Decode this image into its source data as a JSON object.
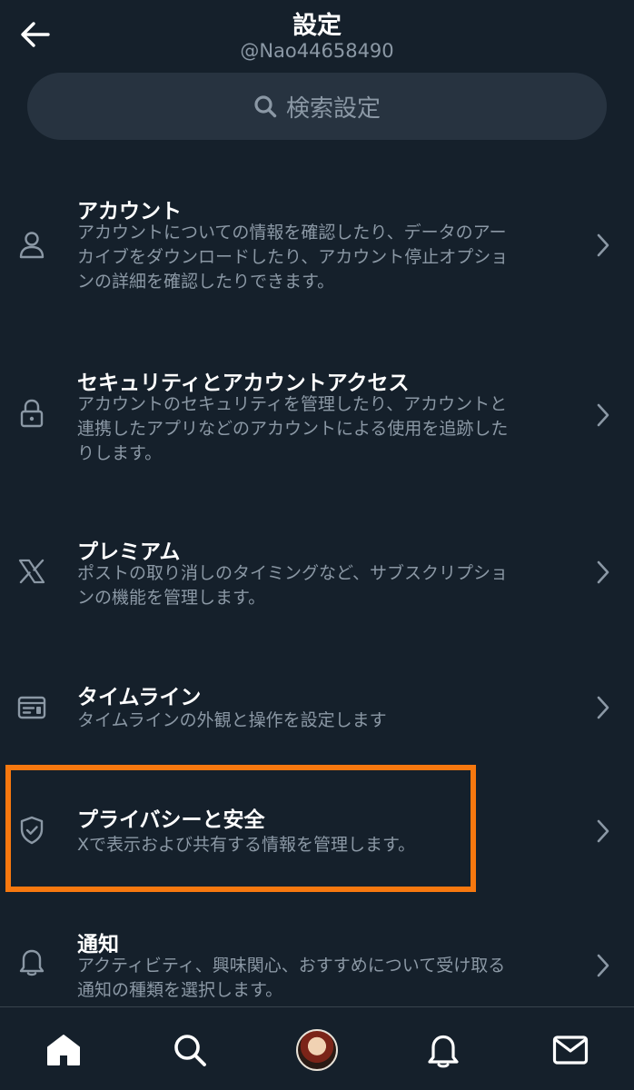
{
  "header": {
    "title": "設定",
    "handle": "@Nao44658490"
  },
  "search": {
    "placeholder": "検索設定"
  },
  "settings": [
    {
      "icon": "person-icon",
      "title": "アカウント",
      "desc_lines": [
        "アカウントについての情報を確認したり、データのアー",
        "カイブをダウンロードしたり、アカウント停止オプショ",
        "ンの詳細を確認したりできます。"
      ]
    },
    {
      "icon": "lock-icon",
      "title": "セキュリティとアカウントアクセス",
      "desc_lines": [
        "アカウントのセキュリティを管理したり、アカウントと",
        "連携したアプリなどのアカウントによる使用を追跡した",
        "りします。"
      ]
    },
    {
      "icon": "x-logo-icon",
      "title": "プレミアム",
      "desc_lines": [
        "ポストの取り消しのタイミングなど、サブスクリプショ",
        "ンの機能を管理します。"
      ]
    },
    {
      "icon": "timeline-icon",
      "title": "タイムライン",
      "desc_lines": [
        "タイムラインの外観と操作を設定します"
      ]
    },
    {
      "icon": "shield-check-icon",
      "title": "プライバシーと安全",
      "desc_lines": [
        "Xで表示および共有する情報を管理します。"
      ]
    },
    {
      "icon": "bell-icon",
      "title": "通知",
      "desc_lines": [
        "アクティビティ、興味関心、おすすめについて受け取る",
        "通知の種類を選択します。"
      ]
    }
  ],
  "colors": {
    "background": "#15202b",
    "search_bg": "#273340",
    "secondary_text": "#8b98a5",
    "highlight": "#f7780f"
  },
  "bottom_nav": [
    "home-icon",
    "search-icon",
    "avatar",
    "bell-icon",
    "mail-icon"
  ]
}
